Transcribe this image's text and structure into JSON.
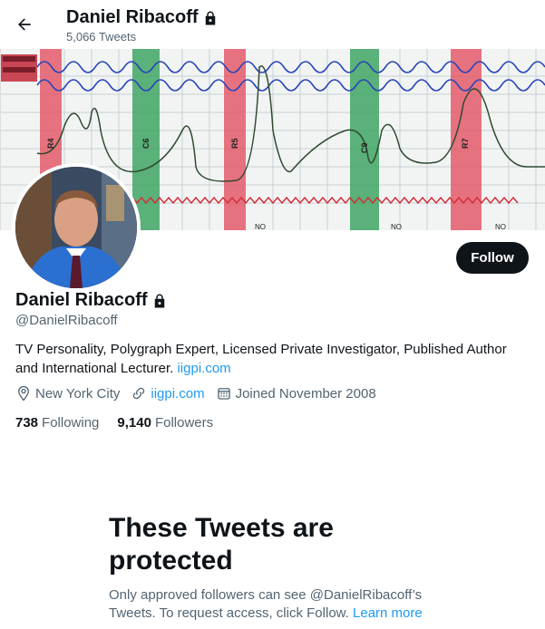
{
  "header": {
    "name": "Daniel Ribacoff",
    "tweet_count": "5,066 Tweets"
  },
  "profile": {
    "name": "Daniel Ribacoff",
    "handle": "@DanielRibacoff",
    "bio": "TV Personality, Polygraph Expert, Licensed Private Investigator, Published Author and International Lecturer.",
    "bio_link": "iigpi.com",
    "location": "New York City",
    "website": "iigpi.com",
    "joined": "Joined November 2008",
    "following_count": "738",
    "following_label": "Following",
    "followers_count": "9,140",
    "followers_label": "Followers",
    "follow_button": "Follow"
  },
  "banner": {
    "labels": [
      "R4",
      "C6",
      "R5",
      "C9",
      "R7"
    ],
    "no_labels": [
      "NO",
      "NO",
      "NO"
    ]
  },
  "protected": {
    "title": "These Tweets are protected",
    "text": "Only approved followers can see @DanielRibacoff’s Tweets. To request access, click Follow.",
    "learn_more": "Learn more"
  },
  "colors": {
    "accent": "#1d9bf0",
    "text": "#0f1419",
    "muted": "#536471"
  }
}
